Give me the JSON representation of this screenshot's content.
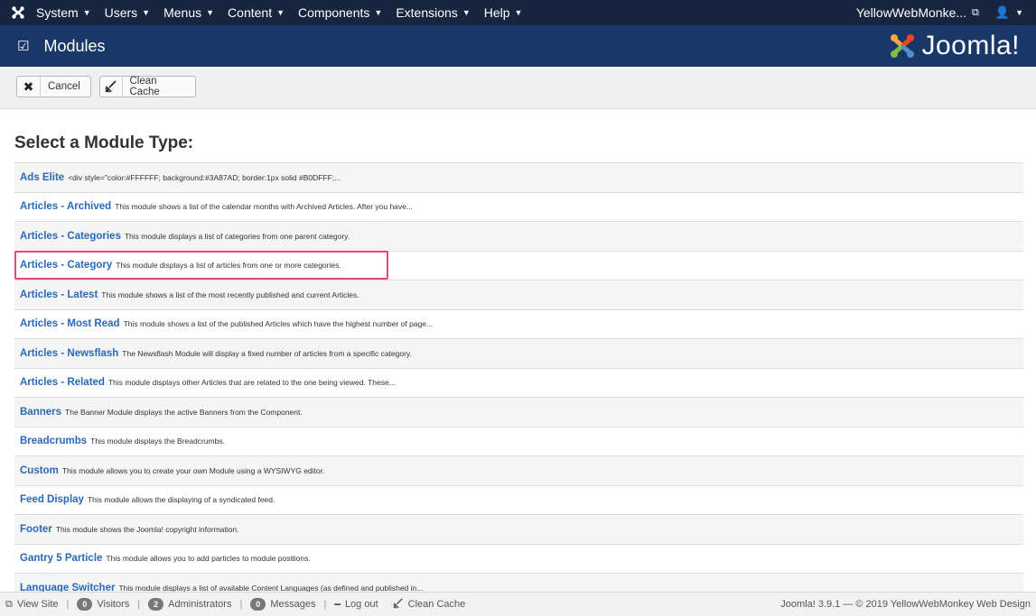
{
  "topnav": {
    "menu": [
      {
        "label": "System"
      },
      {
        "label": "Users"
      },
      {
        "label": "Menus"
      },
      {
        "label": "Content"
      },
      {
        "label": "Components"
      },
      {
        "label": "Extensions"
      },
      {
        "label": "Help"
      }
    ],
    "site_name": "YellowWebMonke...",
    "user_caret": "▾"
  },
  "header": {
    "title": "Modules",
    "brand": "Joomla!"
  },
  "toolbar": {
    "cancel_label": "Cancel",
    "clean_cache_label": "Clean Cache"
  },
  "main": {
    "section_title": "Select a Module Type:",
    "modules": [
      {
        "name": "Ads Elite",
        "desc": "<div style=\"color:#FFFFFF; background:#3A87AD; border:1px solid #B0DFFF;..."
      },
      {
        "name": "Articles - Archived",
        "desc": "This module shows a list of the calendar months with Archived Articles. After you have..."
      },
      {
        "name": "Articles - Categories",
        "desc": "This module displays a list of categories from one parent category."
      },
      {
        "name": "Articles - Category",
        "desc": "This module displays a list of articles from one or more categories."
      },
      {
        "name": "Articles - Latest",
        "desc": "This module shows a list of the most recently published and current Articles."
      },
      {
        "name": "Articles - Most Read",
        "desc": "This module shows a list of the published Articles which have the highest number of page..."
      },
      {
        "name": "Articles - Newsflash",
        "desc": "The Newsflash Module will display a fixed number of articles from a specific category."
      },
      {
        "name": "Articles - Related",
        "desc": "This module displays other Articles that are related to the one being viewed. These..."
      },
      {
        "name": "Banners",
        "desc": "The Banner Module displays the active Banners from the Component."
      },
      {
        "name": "Breadcrumbs",
        "desc": "This module displays the Breadcrumbs."
      },
      {
        "name": "Custom",
        "desc": "This module allows you to create your own Module using a WYSIWYG editor."
      },
      {
        "name": "Feed Display",
        "desc": "This module allows the displaying of a syndicated feed."
      },
      {
        "name": "Footer",
        "desc": "This module shows the Joomla! copyright information."
      },
      {
        "name": "Gantry 5 Particle",
        "desc": "This module allows you to add particles to module positions."
      },
      {
        "name": "Language Switcher",
        "desc": "This module displays a list of available Content Languages (as defined and published in..."
      }
    ]
  },
  "statusbar": {
    "view_site": "View Site",
    "visitors_count": "0",
    "visitors_label": "Visitors",
    "admins_count": "2",
    "admins_label": "Administrators",
    "messages_count": "0",
    "messages_label": "Messages",
    "logout": "Log out",
    "clean_cache": "Clean Cache",
    "footer": "Joomla! 3.9.1 — © 2019 YellowWebMonkey Web Design"
  },
  "colors": {
    "topnav_bg": "#17253f",
    "header_bg": "#1a3867",
    "link": "#2a69b8",
    "highlight": "#e8457f"
  }
}
